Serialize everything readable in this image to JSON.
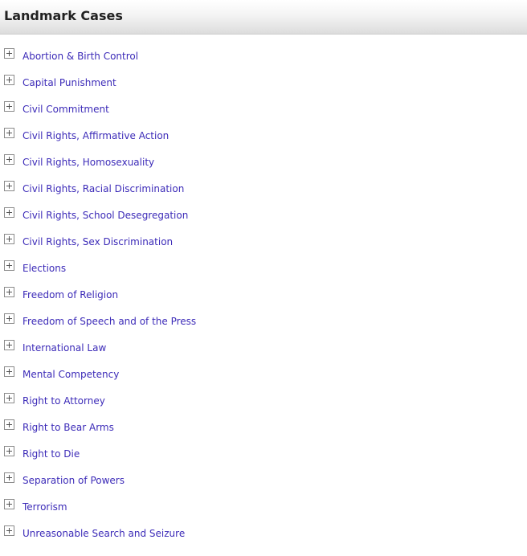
{
  "header": {
    "title": "Landmark Cases"
  },
  "items": [
    {
      "label": "Abortion & Birth Control"
    },
    {
      "label": "Capital Punishment"
    },
    {
      "label": "Civil Commitment"
    },
    {
      "label": "Civil Rights, Affirmative Action"
    },
    {
      "label": "Civil Rights, Homosexuality"
    },
    {
      "label": "Civil Rights, Racial Discrimination"
    },
    {
      "label": "Civil Rights, School Desegregation"
    },
    {
      "label": "Civil Rights, Sex Discrimination"
    },
    {
      "label": "Elections"
    },
    {
      "label": "Freedom of Religion"
    },
    {
      "label": "Freedom of Speech and of the Press"
    },
    {
      "label": "International Law"
    },
    {
      "label": "Mental Competency"
    },
    {
      "label": "Right to Attorney"
    },
    {
      "label": "Right to Bear Arms"
    },
    {
      "label": "Right to Die"
    },
    {
      "label": "Separation of Powers"
    },
    {
      "label": "Terrorism"
    },
    {
      "label": "Unreasonable Search and Seizure"
    }
  ],
  "icons": {
    "expand": "plus-box-icon"
  },
  "colors": {
    "link": "#3c2bb8",
    "title": "#222222"
  }
}
